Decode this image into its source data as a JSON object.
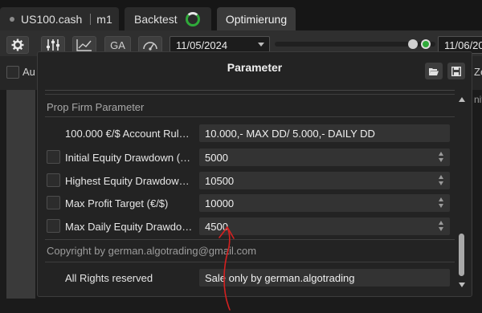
{
  "tabs": {
    "symbol": "US100.cash",
    "timeframe": "m1",
    "backtest": "Backtest",
    "optimierung": "Optimierung"
  },
  "toolbar": {
    "ga_label": "GA",
    "start_date": "11/05/2024",
    "end_date": "11/06/20"
  },
  "background": {
    "left_label": "Au",
    "right_label": "Zer",
    "right_sub": "nit"
  },
  "dialog": {
    "title": "Parameter",
    "section_header": "Prop Firm Parameter",
    "rows": [
      {
        "label": "100.000 €/$ Account Rul…",
        "value": "10.000,- MAX DD/ 5.000,- DAILY DD"
      },
      {
        "label": "Initial Equity Drawdown (…",
        "value": "5000"
      },
      {
        "label": "Highest Equity Drawdow…",
        "value": "10500"
      },
      {
        "label": "Max Profit Target (€/$)",
        "value": "10000"
      },
      {
        "label": "Max Daily Equity Drawdo…",
        "value": "4500"
      }
    ],
    "copyright": "Copyright by german.algotrading@gmail.com",
    "rights_label": "All Rights reserved",
    "rights_value": "Sale only by german.algotrading"
  },
  "colors": {
    "accent_green": "#2faa3a",
    "annotation_red": "#d42020"
  }
}
